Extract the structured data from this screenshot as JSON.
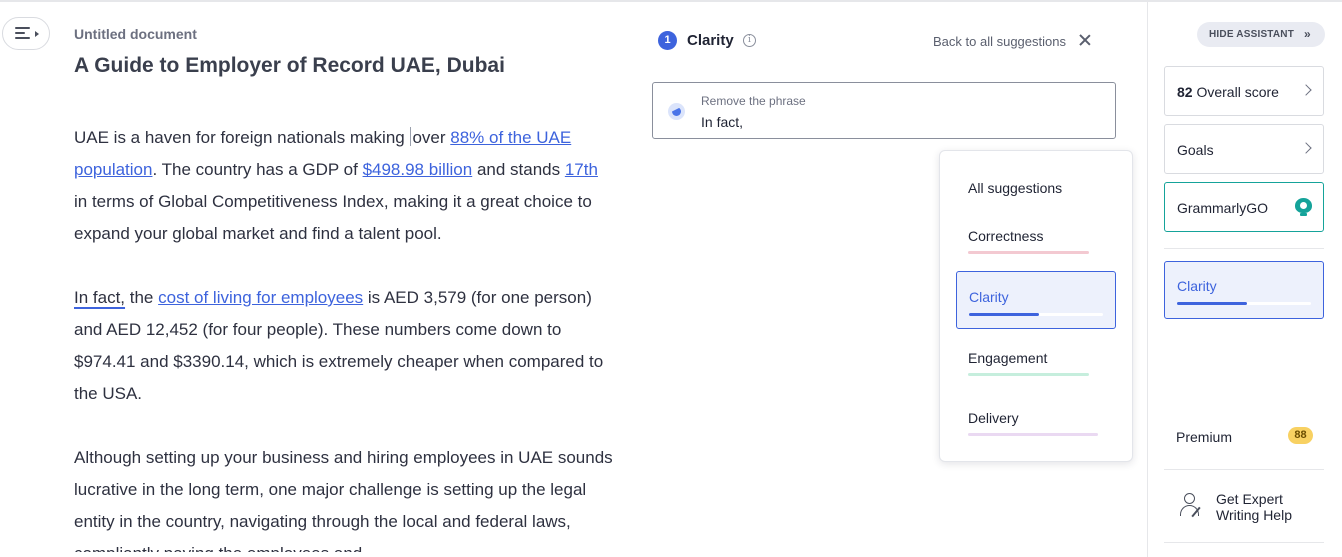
{
  "editor": {
    "doc_title": "Untitled document",
    "heading": "A Guide to Employer of Record UAE, Dubai",
    "p1": {
      "t1": "UAE is a haven for foreign nationals making ",
      "t2": "over ",
      "link1": "88% of the UAE population",
      "t3": ". The country has a GDP of ",
      "link2": "$498.98 billion",
      "t4": " and stands ",
      "link3": "17th",
      "t5": " in terms of Global Competitiveness Index, making it a great choice to expand your global market and find a talent pool."
    },
    "p2": {
      "flagged": "In fact,",
      "t1": " the ",
      "link1": "cost of living for employees",
      "t2": " is AED 3,579 (for one person) and AED 12,452 (for four people). These numbers come down to $974.41 and  $3390.14, which is extremely cheaper when compared to the USA."
    },
    "p3": "Although setting up your business and hiring employees in UAE sounds lucrative in the long term, one major challenge is setting up the legal entity in the country, navigating through the local and federal laws, compliantly paying the employees and"
  },
  "suggestion": {
    "index": "1",
    "category": "Clarity",
    "info_glyph": "i",
    "back_label": "Back to all suggestions",
    "action": "Remove the phrase",
    "phrase": "In fact,"
  },
  "dropdown": {
    "items": [
      "All suggestions",
      "Correctness",
      "Clarity",
      "Engagement",
      "Delivery"
    ],
    "colors": {
      "correctness": "#f3c9d1",
      "clarity": "#3d63dd",
      "engagement": "#c6eedd",
      "delivery": "#ead9f2"
    },
    "clarity_progress": 0.52
  },
  "sidebar": {
    "hide_label": "HIDE ASSISTANT",
    "hide_chevron": "»",
    "score": "82",
    "score_label": " Overall score",
    "goals_label": "Goals",
    "go_label": "GrammarlyGO",
    "clarity_label": "Clarity",
    "clarity_progress": 0.52,
    "premium_label": "Premium",
    "premium_count": "88",
    "expert_line1": "Get Expert",
    "expert_line2": "Writing Help"
  },
  "colors": {
    "accent": "#3d63dd",
    "go_teal": "#15a39a",
    "premium_yellow": "#f8d162"
  }
}
